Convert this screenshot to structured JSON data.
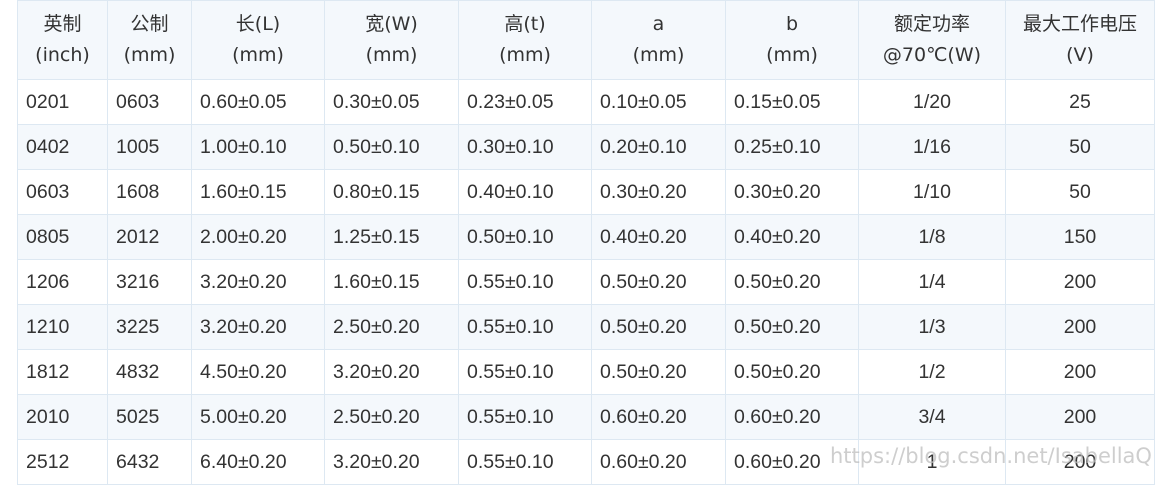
{
  "headers": [
    {
      "line1": "英制",
      "line2": "(inch)"
    },
    {
      "line1": "公制",
      "line2": "(mm)"
    },
    {
      "line1": "长(L)",
      "line2": "(mm)"
    },
    {
      "line1": "宽(W)",
      "line2": "(mm)"
    },
    {
      "line1": "高(t)",
      "line2": "(mm)"
    },
    {
      "line1": "a",
      "line2": "(mm)"
    },
    {
      "line1": "b",
      "line2": "(mm)"
    },
    {
      "line1": "额定功率",
      "line2": "@70℃(W)"
    },
    {
      "line1": "最大工作电压",
      "line2": "(V)"
    }
  ],
  "rows": [
    [
      "0201",
      "0603",
      "0.60±0.05",
      "0.30±0.05",
      "0.23±0.05",
      "0.10±0.05",
      "0.15±0.05",
      "1/20",
      "25"
    ],
    [
      "0402",
      "1005",
      "1.00±0.10",
      "0.50±0.10",
      "0.30±0.10",
      "0.20±0.10",
      "0.25±0.10",
      "1/16",
      "50"
    ],
    [
      "0603",
      "1608",
      "1.60±0.15",
      "0.80±0.15",
      "0.40±0.10",
      "0.30±0.20",
      "0.30±0.20",
      "1/10",
      "50"
    ],
    [
      "0805",
      "2012",
      "2.00±0.20",
      "1.25±0.15",
      "0.50±0.10",
      "0.40±0.20",
      "0.40±0.20",
      "1/8",
      "150"
    ],
    [
      "1206",
      "3216",
      "3.20±0.20",
      "1.60±0.15",
      "0.55±0.10",
      "0.50±0.20",
      "0.50±0.20",
      "1/4",
      "200"
    ],
    [
      "1210",
      "3225",
      "3.20±0.20",
      "2.50±0.20",
      "0.55±0.10",
      "0.50±0.20",
      "0.50±0.20",
      "1/3",
      "200"
    ],
    [
      "1812",
      "4832",
      "4.50±0.20",
      "3.20±0.20",
      "0.55±0.10",
      "0.50±0.20",
      "0.50±0.20",
      "1/2",
      "200"
    ],
    [
      "2010",
      "5025",
      "5.00±0.20",
      "2.50±0.20",
      "0.55±0.10",
      "0.60±0.20",
      "0.60±0.20",
      "3/4",
      "200"
    ],
    [
      "2512",
      "6432",
      "6.40±0.20",
      "3.20±0.20",
      "0.55±0.10",
      "0.60±0.20",
      "0.60±0.20",
      "1",
      "200"
    ]
  ],
  "watermark": "https://blog.csdn.net/IsabellaQ",
  "colors": {
    "border": "#dde8f2",
    "header_bg": "#f4f8fc",
    "text": "#333333"
  }
}
